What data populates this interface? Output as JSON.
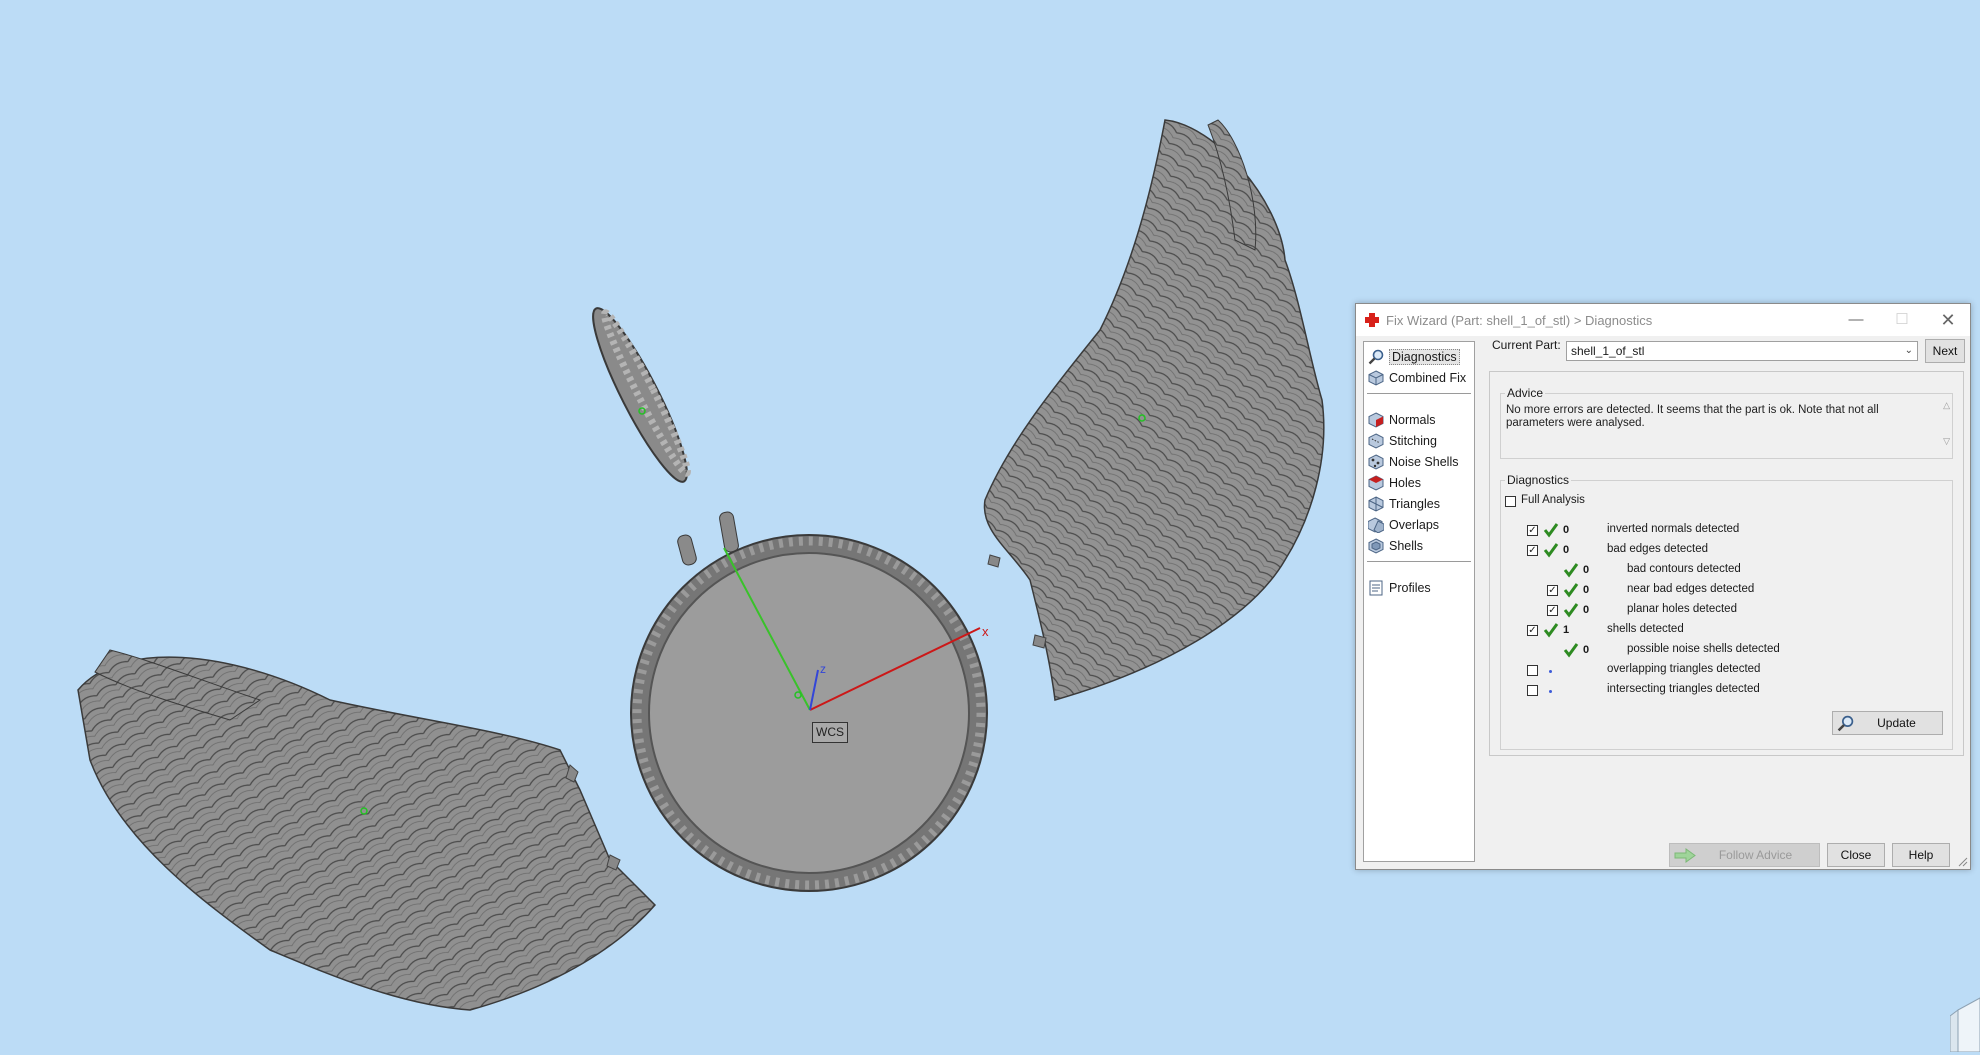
{
  "viewport": {
    "wcs_label": "WCS",
    "axes": {
      "x": "x",
      "z": "z"
    },
    "background_color": "#bcdcf6",
    "model_color": "#8f8f8f"
  },
  "dialog": {
    "title": "Fix Wizard (Part: shell_1_of_stl) > Diagnostics",
    "nav": {
      "items": [
        {
          "label": "Diagnostics",
          "icon": "magnifier-icon",
          "selected": true
        },
        {
          "label": "Combined Fix",
          "icon": "cube-icon"
        },
        {
          "label": "Normals",
          "icon": "normals-cube-icon"
        },
        {
          "label": "Stitching",
          "icon": "stitching-cube-icon"
        },
        {
          "label": "Noise Shells",
          "icon": "noise-shells-icon"
        },
        {
          "label": "Holes",
          "icon": "holes-cube-icon"
        },
        {
          "label": "Triangles",
          "icon": "triangles-icon"
        },
        {
          "label": "Overlaps",
          "icon": "overlaps-icon"
        },
        {
          "label": "Shells",
          "icon": "shells-icon"
        },
        {
          "label": "Profiles",
          "icon": "profiles-icon"
        }
      ]
    },
    "current_part_label": "Current Part:",
    "current_part_value": "shell_1_of_stl",
    "next_label": "Next",
    "advice": {
      "title": "Advice",
      "text": "No more errors are detected. It seems that the part is ok. Note that not all parameters were analysed."
    },
    "diagnostics": {
      "title": "Diagnostics",
      "full_analysis_label": "Full Analysis",
      "full_analysis_checked": false,
      "rows": [
        {
          "checked": true,
          "status": "ok",
          "count": "0",
          "label": "inverted normals detected"
        },
        {
          "checked": true,
          "status": "ok",
          "count": "0",
          "label": "bad edges detected"
        },
        {
          "status": "ok",
          "count": "0",
          "label": "bad contours detected"
        },
        {
          "checked": true,
          "status": "ok",
          "count": "0",
          "label": "near bad edges detected"
        },
        {
          "checked": true,
          "status": "ok",
          "count": "0",
          "label": "planar holes detected"
        },
        {
          "checked": true,
          "status": "ok",
          "count": "1",
          "label": "shells detected"
        },
        {
          "status": "ok",
          "count": "0",
          "label": "possible noise shells detected"
        },
        {
          "checked": false,
          "status": "not-analysed",
          "count": "",
          "label": "overlapping triangles detected"
        },
        {
          "checked": false,
          "status": "not-analysed",
          "count": "",
          "label": "intersecting triangles detected"
        }
      ],
      "update_label": "Update"
    },
    "buttons": {
      "follow_advice": "Follow Advice",
      "close": "Close",
      "help": "Help"
    },
    "colors": {
      "check_green": "#2e8b22",
      "accent_red": "#d8211a"
    }
  }
}
